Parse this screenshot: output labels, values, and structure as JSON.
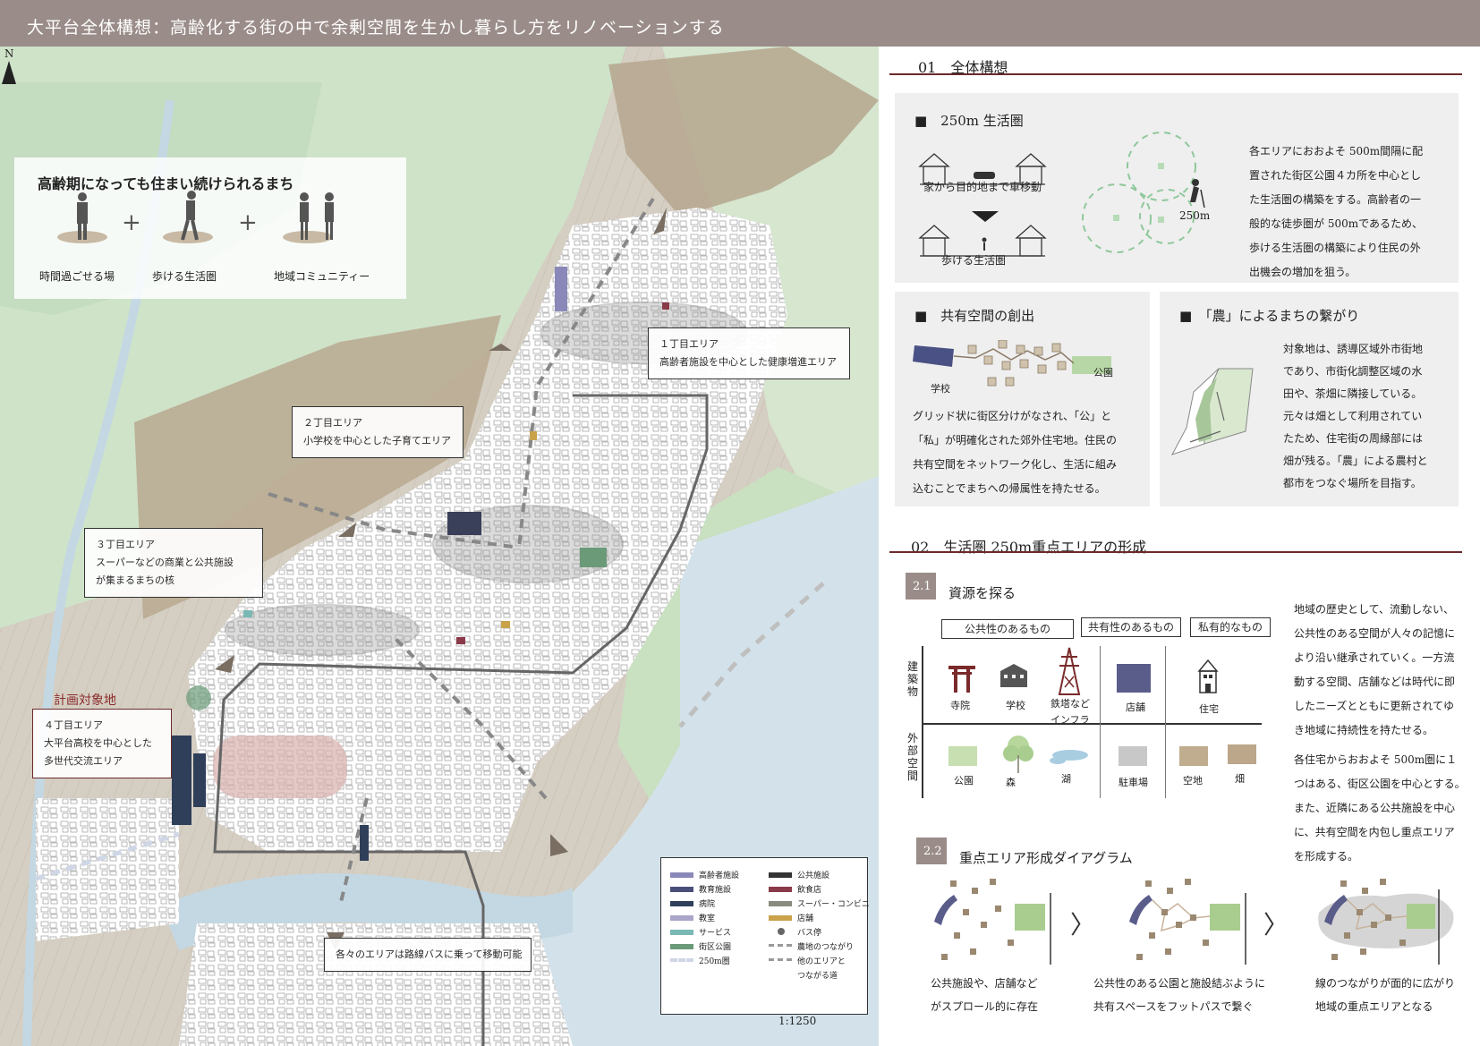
{
  "header": {
    "title": "大平台全体構想：高齢化する街の中で余剰空間を生かし暮らし方をリノベーションする"
  },
  "map": {
    "intro": {
      "title": "高齢期になっても住まい続けられるまち",
      "labels": [
        "時間過ごせる場",
        "歩ける生活圏",
        "地域コミュニティー"
      ],
      "plus": "+"
    },
    "areas": [
      {
        "name": "１丁目エリア",
        "desc": "高齢者施設を中心とした健康増進エリア"
      },
      {
        "name": "２丁目エリア",
        "desc": "小学校を中心とした子育てエリア"
      },
      {
        "name": "３丁目エリア",
        "desc": [
          "スーパーなどの商業と公共施設",
          "が集まるまちの核"
        ]
      },
      {
        "name": "４丁目エリア",
        "desc": [
          "大平台高校を中心とした",
          "多世代交流エリア"
        ]
      }
    ],
    "target_label": "計画対象地",
    "bus_note": "各々のエリアは路線バスに乗って移動可能",
    "legend": [
      {
        "label": "高齢者施設",
        "color": "#8a88b8"
      },
      {
        "label": "公共施設",
        "color": "#333333"
      },
      {
        "label": "教育施設",
        "color": "#4a4f7a"
      },
      {
        "label": "飲食店",
        "color": "#8b3a4a"
      },
      {
        "label": "病院",
        "color": "#2f3f5a"
      },
      {
        "label": "スーパー・コンビニ",
        "color": "#8a8a80"
      },
      {
        "label": "教室",
        "color": "#a9a6c8"
      },
      {
        "label": "店舗",
        "color": "#c9a24a"
      },
      {
        "label": "サービス",
        "color": "#7ab8b4"
      },
      {
        "label": "バス停",
        "color": "#666666"
      },
      {
        "label": "街区公園",
        "color": "#6b9a78"
      },
      {
        "label": "農地のつながり",
        "color": "#999999"
      },
      {
        "label": "250m圏",
        "color": "#cfd6e6"
      },
      {
        "label": "他のエリアと",
        "color": "#999999"
      },
      {
        "label": "つながる道",
        "color": ""
      }
    ],
    "north": "N",
    "scale": "1:1250"
  },
  "section1": {
    "number": "01",
    "title": "全体構想",
    "p250": {
      "title": "■　250m 生活圏",
      "car_label": "家から目的地まで車移動",
      "walk_label": "歩ける生活圏",
      "radius_label": "250m",
      "text": [
        "各エリアにおおよそ 500m間隔に配",
        "置された街区公園４カ所を中心とし",
        "た生活圏の構築をする。高齢者の一",
        "般的な徒歩圏が 500mであるため、",
        "歩ける生活圏の構築により住民の外",
        "出機会の増加を狙う。"
      ]
    },
    "shared": {
      "title": "■　共有空間の創出",
      "school_label": "学校",
      "park_label": "公園",
      "text": [
        "グリッド状に街区分けがなされ、「公」と",
        "「私」が明確化された郊外住宅地。住民の",
        "共有空間をネットワーク化し、生活に組み",
        "込むことでまちへの帰属性を持たせる。"
      ]
    },
    "farm": {
      "title": "■　「農」によるまちの繋がり",
      "text": [
        "対象地は、誘導区域外市街地",
        "であり、市街化調整区域の水",
        "田や、茶畑に隣接している。",
        "元々は畑として利用されてい",
        "たため、住宅街の周縁部には",
        "畑が残る。「農」による農村と",
        "都市をつなぐ場所を目指す。"
      ]
    }
  },
  "section2": {
    "number": "02",
    "title": "生活圏 250m重点エリアの形成",
    "s21": {
      "badge": "2.1",
      "title": "資源を探る",
      "categories": [
        "公共性のあるもの",
        "共有性のあるもの",
        "私有的なもの"
      ],
      "row_building": "建築物",
      "row_outside": "外部空間",
      "buildings": [
        "寺院",
        "学校",
        "鉄塔など",
        "インフラ",
        "店舗",
        "住宅"
      ],
      "outside": [
        "公園",
        "森",
        "湖",
        "駐車場",
        "空地",
        "畑"
      ],
      "text1": [
        "地域の歴史として、流動しない、",
        "公共性のある空間が人々の記憶に",
        "より沿い継承されていく。一方流",
        "動する空間、店舗などは時代に即",
        "したニーズとともに更新されてゆ",
        "き地域に持続性を持たせる。"
      ],
      "text2": [
        "各住宅からおおよそ 500m圏に１",
        "つはある、街区公園を中心とする。",
        "また、近隣にある公共施設を中心",
        "に、共有空間を内包し重点エリア",
        "を形成する。"
      ]
    },
    "s22": {
      "badge": "2.2",
      "title": "重点エリア形成ダイアグラム",
      "arrow": "〉",
      "captions": [
        [
          "公共施設や、店舗など",
          "がスプロール的に存在"
        ],
        [
          "公共性のある公園と施設結ぶように",
          "共有スペースをフットパスで繋ぐ"
        ],
        [
          "線のつながりが面的に広がり",
          "地域の重点エリアとなる"
        ]
      ]
    }
  }
}
